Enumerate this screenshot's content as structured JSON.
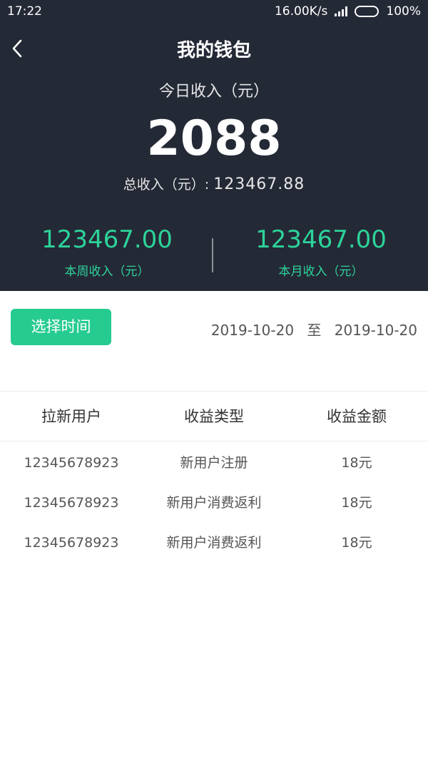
{
  "status_bar": {
    "time": "17:22",
    "speed": "16.00K/s",
    "battery": "100%"
  },
  "nav": {
    "title": "我的钱包",
    "back_icon": "chevron-left-icon"
  },
  "summary": {
    "today_label": "今日收入（元）",
    "today_value": "2088",
    "total_label": "总收入（元）:",
    "total_value": "123467.88",
    "week_value": "123467.00",
    "week_label": "本周收入（元）",
    "month_value": "123467.00",
    "month_label": "本月收入（元）"
  },
  "filter": {
    "select_time_label": "选择时间",
    "start_date": "2019-10-20",
    "separator": "至",
    "end_date": "2019-10-20"
  },
  "table": {
    "headers": [
      "拉新用户",
      "收益类型",
      "收益金额"
    ],
    "rows": [
      [
        "12345678923",
        "新用户注册",
        "18元"
      ],
      [
        "12345678923",
        "新用户消费返利",
        "18元"
      ],
      [
        "12345678923",
        "新用户消费返利",
        "18元"
      ]
    ]
  },
  "colors": {
    "header_bg": "#242936",
    "accent_green": "#2dd39a",
    "button_green": "#26cb90"
  }
}
